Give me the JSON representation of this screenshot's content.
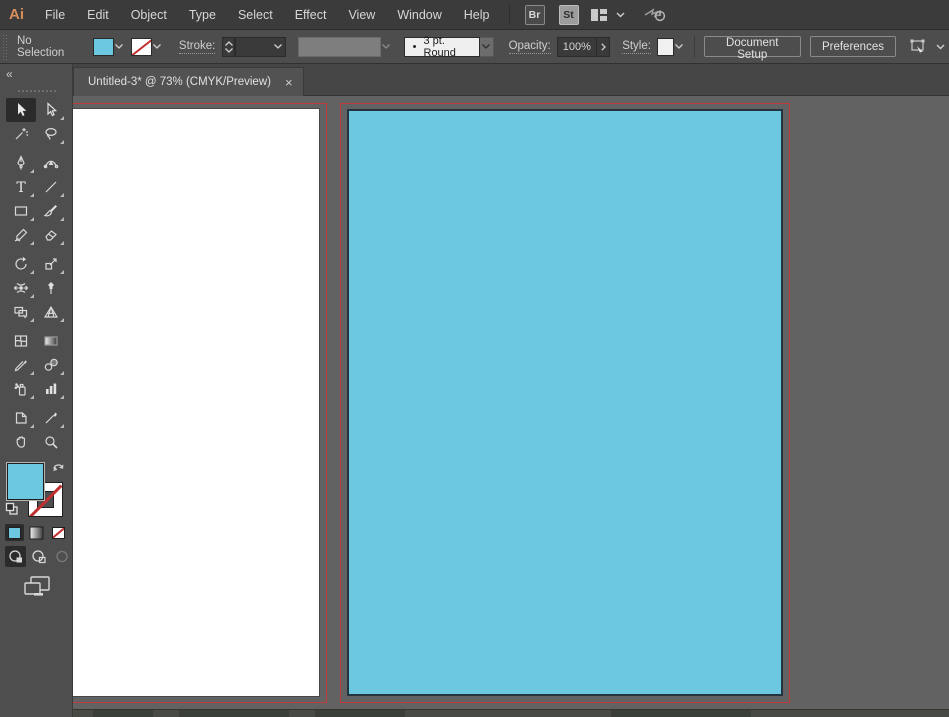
{
  "app": {
    "logo_text": "Ai"
  },
  "menu_bar": {
    "items": [
      "File",
      "Edit",
      "Object",
      "Type",
      "Select",
      "Effect",
      "View",
      "Window",
      "Help"
    ],
    "bridge_button": "Br",
    "stock_button": "St"
  },
  "control_bar": {
    "selection_status": "No Selection",
    "stroke_label": "Stroke:",
    "brush_bullet": "•",
    "brush_definition": "3 pt. Round",
    "opacity_label": "Opacity:",
    "opacity_value": "100%",
    "style_label": "Style:",
    "document_setup_button": "Document Setup",
    "preferences_button": "Preferences"
  },
  "document_tab": {
    "title": "Untitled-3* @ 73% (CMYK/Preview)",
    "close_glyph": "×"
  },
  "toolbar": {
    "collapse_glyph": "«",
    "active_tool": "Selection",
    "tools": [
      "Selection",
      "Direct Selection",
      "Magic Wand",
      "Lasso",
      "Pen",
      "Curvature",
      "Type",
      "Line Segment",
      "Rectangle",
      "Paintbrush",
      "Shaper",
      "Eraser",
      "Rotate",
      "Scale",
      "Width",
      "Puppet Warp",
      "Shape Builder",
      "Perspective Grid",
      "Mesh",
      "Gradient",
      "Eyedropper",
      "Blend",
      "Symbol Sprayer",
      "Column Graph",
      "Artboard",
      "Slice",
      "Hand",
      "Zoom"
    ]
  },
  "colors": {
    "fill_swatch": "#6bc8e0",
    "bleed_guide_red": "#c03c3c",
    "artboard_white": "#ffffff",
    "artboard_cyan": "#6bc8e0"
  },
  "canvas": {
    "zoom_level": "73%",
    "color_mode": "CMYK/Preview",
    "artboards": [
      {
        "name": "artboard-1",
        "fill": "#ffffff"
      },
      {
        "name": "artboard-2",
        "fill": "#6bc8e0"
      }
    ]
  }
}
